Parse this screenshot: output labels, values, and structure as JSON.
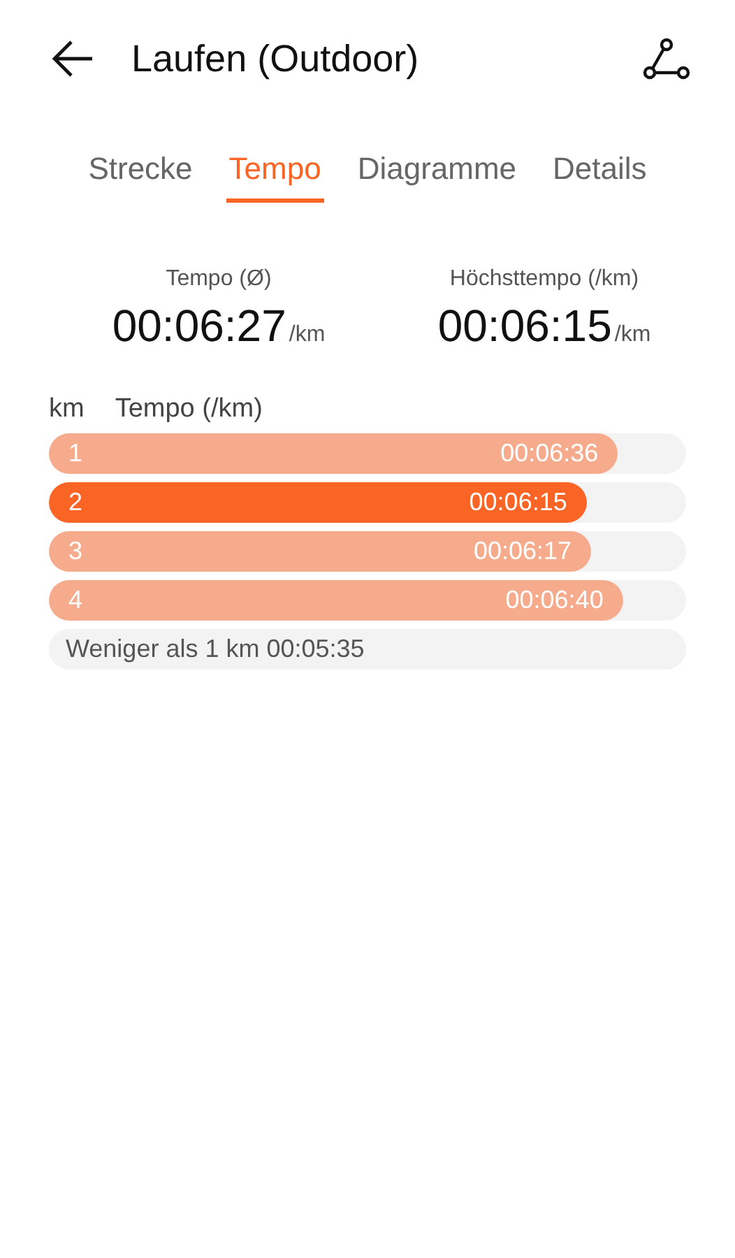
{
  "header": {
    "title": "Laufen (Outdoor)"
  },
  "tabs": [
    {
      "label": "Strecke",
      "selected": false
    },
    {
      "label": "Tempo",
      "selected": true
    },
    {
      "label": "Diagramme",
      "selected": false
    },
    {
      "label": "Details",
      "selected": false
    }
  ],
  "stats": [
    {
      "label": "Tempo (Ø)",
      "value": "00:06:27",
      "unit": "/km"
    },
    {
      "label": "Höchsttempo (/km)",
      "value": "00:06:15",
      "unit": "/km"
    }
  ],
  "splits": {
    "columns": [
      "km",
      "Tempo (/km)"
    ],
    "rows": [
      {
        "km": "1",
        "pace": "00:06:36",
        "level": 0.893,
        "highlighted": false
      },
      {
        "km": "2",
        "pace": "00:06:15",
        "level": 0.844,
        "highlighted": true
      },
      {
        "km": "3",
        "pace": "00:06:17",
        "level": 0.851,
        "highlighted": false
      },
      {
        "km": "4",
        "pace": "00:06:40",
        "level": 0.901,
        "highlighted": false
      }
    ],
    "remainder": "Weniger als 1 km 00:05:35"
  }
}
